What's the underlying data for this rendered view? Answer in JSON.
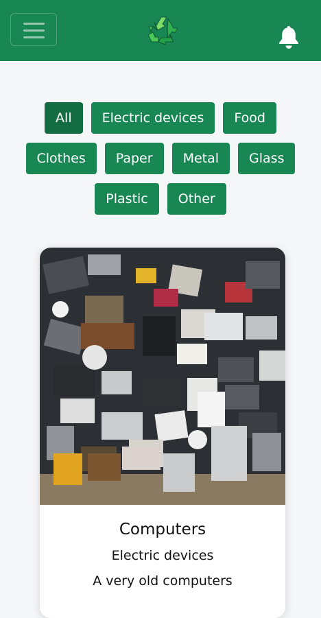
{
  "navbar": {
    "brand_color": "#198754",
    "menu_icon": "hamburger-icon",
    "logo_icon": "recycle-icon",
    "notification_icon": "bell-icon"
  },
  "filters": {
    "active": "All",
    "items": [
      "All",
      "Electric devices",
      "Food",
      "Clothes",
      "Paper",
      "Metal",
      "Glass",
      "Plastic",
      "Other"
    ]
  },
  "card": {
    "image_icon": "electronic-waste-photo",
    "title": "Computers",
    "category": "Electric devices",
    "description": "A very old computers"
  }
}
